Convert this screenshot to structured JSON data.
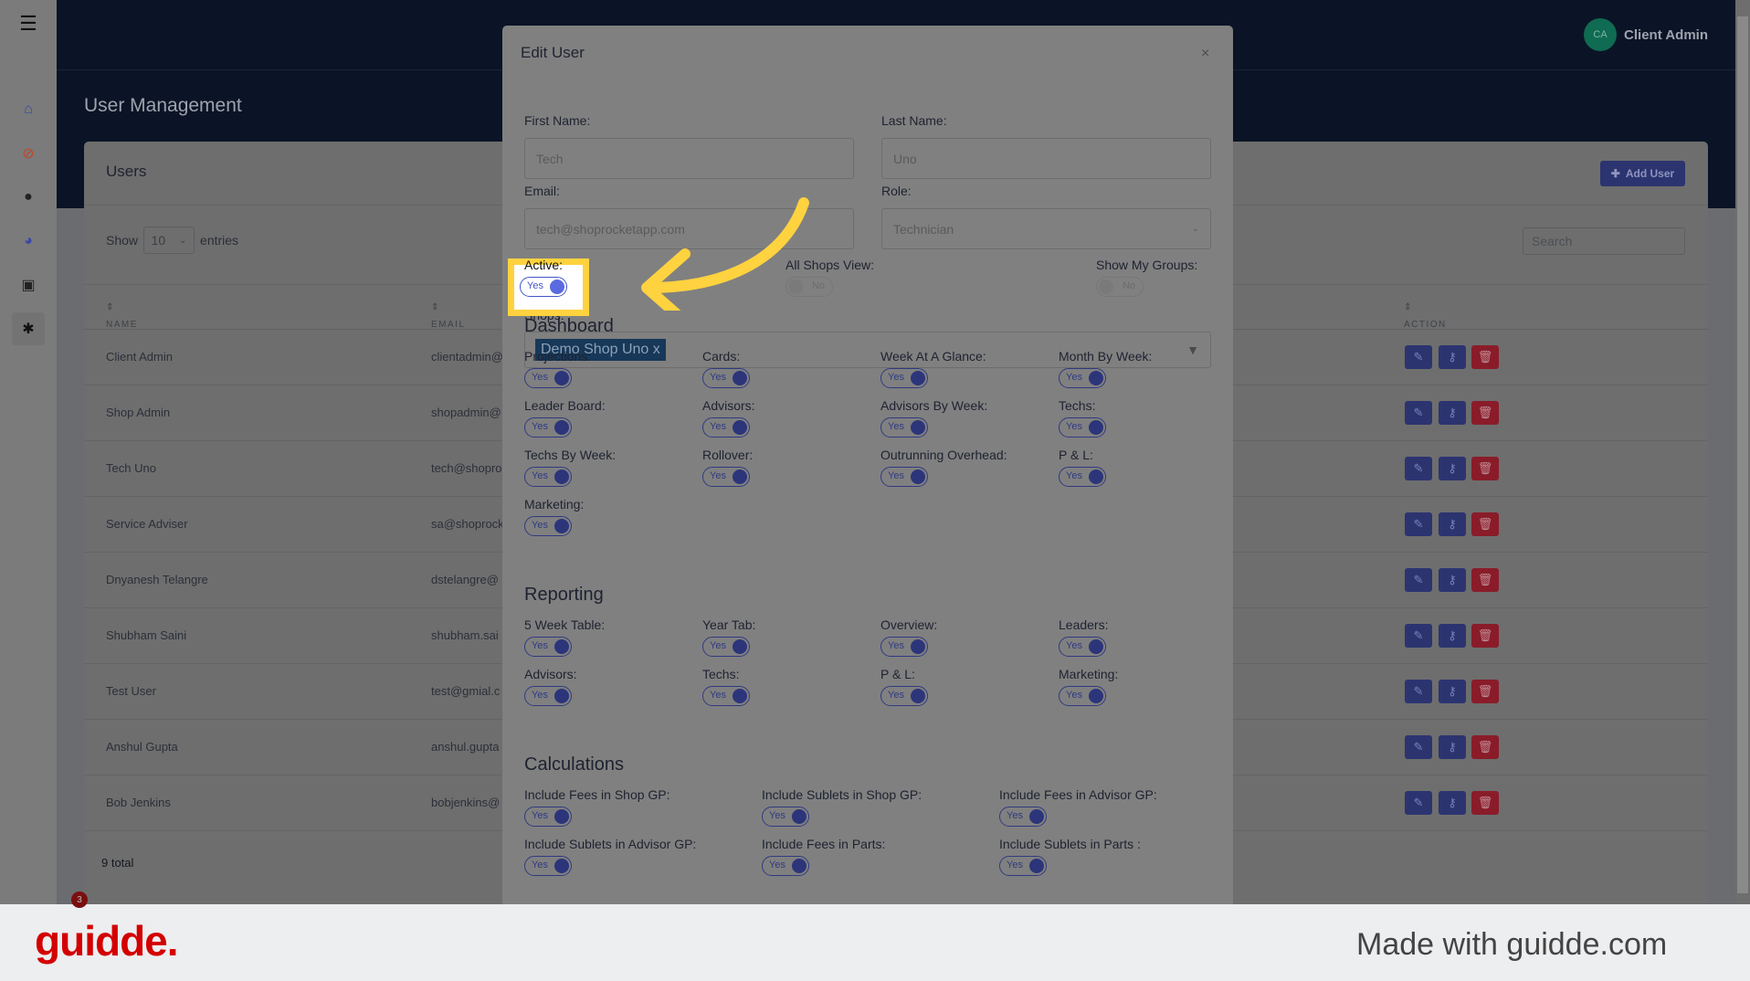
{
  "header": {
    "title": "User Management",
    "user_initials": "CA",
    "user_name": "Client Admin"
  },
  "sidebar": {
    "items": [
      {
        "icon": "store-icon",
        "color": "#3a47a8"
      },
      {
        "icon": "compass-icon",
        "color": "#c0442a"
      },
      {
        "icon": "user-icon",
        "color": "#222"
      },
      {
        "icon": "pie-chart-icon",
        "color": "#3a47a8"
      },
      {
        "icon": "archive-icon",
        "color": "#222"
      },
      {
        "icon": "gear-icon",
        "color": "#111",
        "active": true
      }
    ]
  },
  "card": {
    "title": "Users",
    "add_user_label": "Add User",
    "show_label": "Show",
    "entries_value": "10",
    "entries_label": "entries",
    "search_placeholder": "Search",
    "total": "9 total",
    "columns": {
      "name": "NAME",
      "email": "EMAIL",
      "action": "ACTION"
    },
    "rows": [
      {
        "name": "Client Admin",
        "email": "clientadmin@"
      },
      {
        "name": "Shop Admin",
        "email": "shopadmin@"
      },
      {
        "name": "Tech Uno",
        "email": "tech@shopro"
      },
      {
        "name": "Service Adviser",
        "email": "sa@shoprock"
      },
      {
        "name": "Dnyanesh Telangre",
        "email": "dstelangre@"
      },
      {
        "name": "Shubham Saini",
        "email": "shubham.sai"
      },
      {
        "name": "Test User",
        "email": "test@gmial.c"
      },
      {
        "name": "Anshul Gupta",
        "email": "anshul.gupta"
      },
      {
        "name": "Bob Jenkins",
        "email": "bobjenkins@"
      }
    ]
  },
  "modal": {
    "title": "Edit User",
    "close": "×",
    "first_name_label": "First Name:",
    "first_name": "Tech",
    "last_name_label": "Last Name:",
    "last_name": "Uno",
    "email_label": "Email:",
    "email": "tech@shoprocketapp.com",
    "role_label": "Role:",
    "role": "Technician",
    "active_label": "Active:",
    "active": "Yes",
    "all_shops_label": "All Shops View:",
    "all_shops": "No",
    "groups_label": "Show My Groups:",
    "groups": "No",
    "shops_label": "Shops:",
    "shop_chip": "Demo Shop Uno x",
    "sections": [
      {
        "title": "Dashboard",
        "cols": 4,
        "items": [
          "Projections:",
          "Cards:",
          "Week At A Glance:",
          "Month By Week:",
          "Leader Board:",
          "Advisors:",
          "Advisors By Week:",
          "Techs:",
          "Techs By Week:",
          "Rollover:",
          "Outrunning Overhead:",
          "P & L:",
          "Marketing:"
        ]
      },
      {
        "title": "Reporting",
        "cols": 4,
        "items": [
          "5 Week Table:",
          "Year Tab:",
          "Overview:",
          "Leaders:",
          "Advisors:",
          "Techs:",
          "P & L:",
          "Marketing:"
        ]
      },
      {
        "title": "Calculations",
        "cols": 3,
        "items": [
          "Include Fees in Shop GP:",
          "Include Sublets in Shop GP:",
          "Include Fees in Advisor GP:",
          "Include Sublets in Advisor GP:",
          "Include Fees in Parts:",
          "Include Sublets in Parts :"
        ]
      }
    ],
    "toggle_on": "Yes"
  },
  "footer": {
    "logo": "guidde.",
    "made_with": "Made with guidde.com",
    "chat_badge": "3"
  },
  "colors": {
    "accent": "#2f3a80",
    "highlight": "#ffd23f",
    "danger": "#8a1c2a",
    "brand": "#d40000"
  }
}
